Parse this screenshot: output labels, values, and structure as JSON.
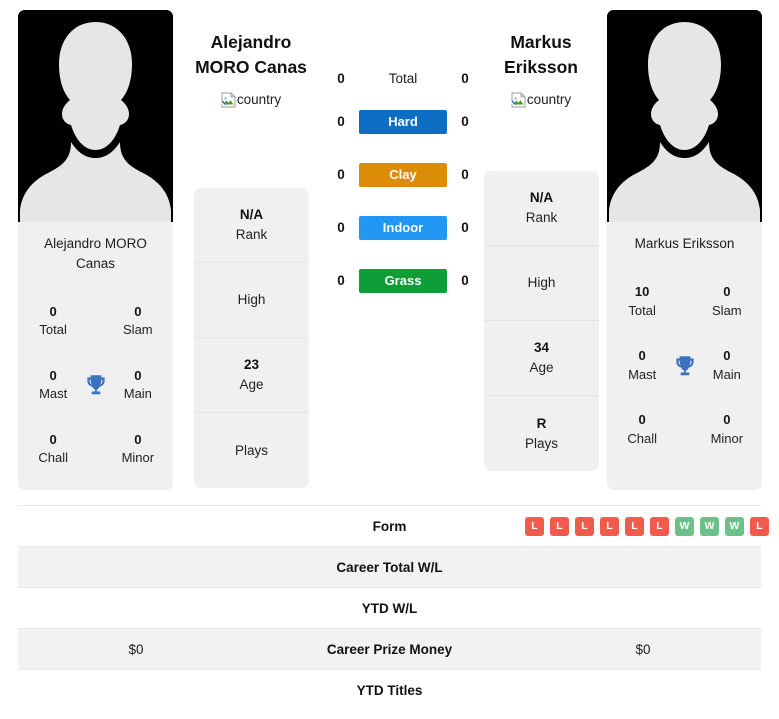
{
  "players": {
    "left": {
      "display_name_line1": "Alejandro",
      "display_name_line2": "MORO Canas",
      "country_label": "country",
      "card_name": "Alejandro MORO Canas",
      "titles": {
        "total_value": "0",
        "total_label": "Total",
        "slam_value": "0",
        "slam_label": "Slam",
        "mast_value": "0",
        "mast_label": "Mast",
        "main_value": "0",
        "main_label": "Main",
        "chall_value": "0",
        "chall_label": "Chall",
        "minor_value": "0",
        "minor_label": "Minor"
      },
      "info": {
        "rank_value": "N/A",
        "rank_label": "Rank",
        "high_value": "",
        "high_label": "High",
        "age_value": "23",
        "age_label": "Age",
        "plays_value": "",
        "plays_label": "Plays"
      },
      "surface_wins": {
        "total": "0",
        "hard": "0",
        "clay": "0",
        "indoor": "0",
        "grass": "0"
      },
      "career_total_wl": "",
      "ytd_wl": "",
      "career_prize_money": "$0",
      "ytd_titles": ""
    },
    "right": {
      "display_name_line1": "Markus",
      "display_name_line2": "Eriksson",
      "country_label": "country",
      "card_name": "Markus Eriksson",
      "titles": {
        "total_value": "10",
        "total_label": "Total",
        "slam_value": "0",
        "slam_label": "Slam",
        "mast_value": "0",
        "mast_label": "Mast",
        "main_value": "0",
        "main_label": "Main",
        "chall_value": "0",
        "chall_label": "Chall",
        "minor_value": "0",
        "minor_label": "Minor"
      },
      "info": {
        "rank_value": "N/A",
        "rank_label": "Rank",
        "high_value": "",
        "high_label": "High",
        "age_value": "34",
        "age_label": "Age",
        "plays_value": "R",
        "plays_label": "Plays"
      },
      "surface_wins": {
        "total": "0",
        "hard": "0",
        "clay": "0",
        "indoor": "0",
        "grass": "0"
      },
      "career_total_wl": "",
      "ytd_wl": "",
      "career_prize_money": "$0",
      "ytd_titles": ""
    }
  },
  "surfaces": {
    "total_label": "Total",
    "hard_label": "Hard",
    "clay_label": "Clay",
    "indoor_label": "Indoor",
    "grass_label": "Grass"
  },
  "rows": {
    "form_label": "Form",
    "career_total_wl_label": "Career Total W/L",
    "ytd_wl_label": "YTD W/L",
    "career_prize_money_label": "Career Prize Money",
    "ytd_titles_label": "YTD Titles"
  },
  "form": {
    "right_results": [
      "L",
      "L",
      "L",
      "L",
      "L",
      "L",
      "W",
      "W",
      "W",
      "L"
    ]
  },
  "colors": {
    "hard": "#0d6ec4",
    "clay": "#dd8c07",
    "indoor": "#2196f3",
    "grass": "#0f9d38",
    "win": "#6cc08a",
    "loss": "#ef5b4c",
    "trophy": "#3b72bd",
    "card_bg": "#f0f0f0"
  }
}
